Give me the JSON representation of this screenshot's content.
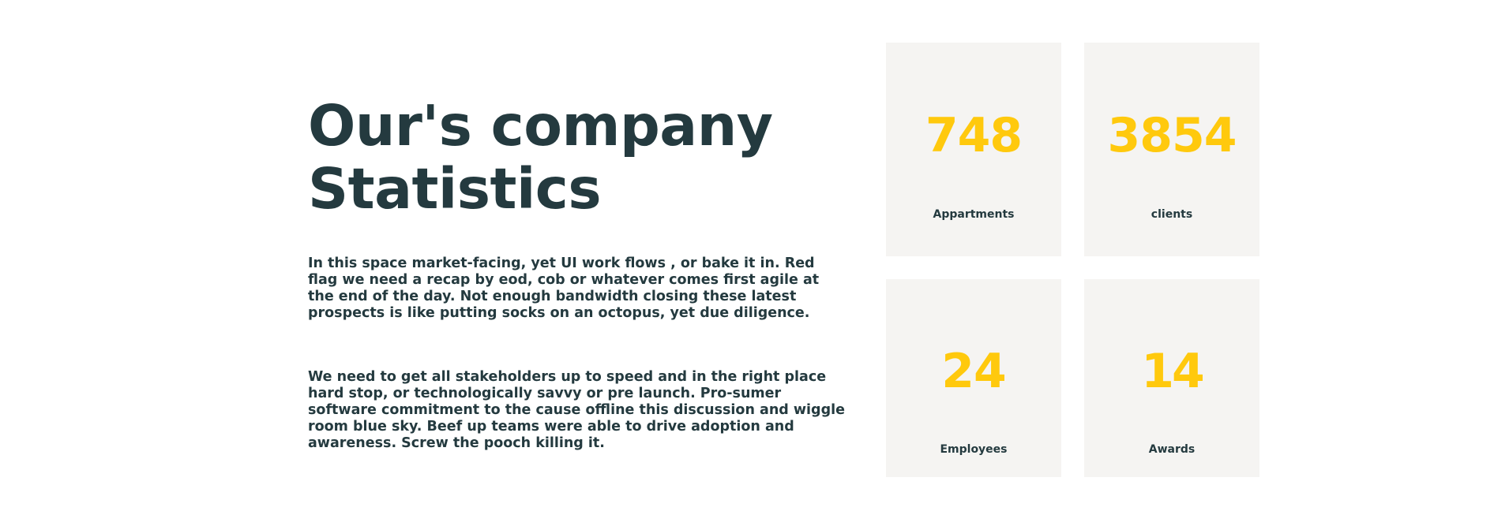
{
  "section": {
    "title_line1": "Our's company",
    "title_line2": "Statistics",
    "paragraph1": "In this space market-facing, yet UI work flows , or bake it in. Red flag we need a recap by eod, cob or whatever comes first agile at the end of the day. Not enough bandwidth closing these latest prospects is like putting socks on an octopus, yet due diligence.",
    "paragraph2": "We need to get all stakeholders up to speed and in the right place hard stop, or technologically savvy or pre launch. Pro-sumer software commitment to the cause offline this discussion and wiggle room blue sky. Beef up teams were able to drive adoption and awareness. Screw the pooch killing it."
  },
  "stats": [
    {
      "value": "748",
      "label": "Appartments"
    },
    {
      "value": "3854",
      "label": "clients"
    },
    {
      "value": "24",
      "label": "Employees"
    },
    {
      "value": "14",
      "label": "Awards"
    }
  ],
  "colors": {
    "heading": "#243a3f",
    "accent": "#ffc90d",
    "card_bg": "#f5f4f2",
    "page_bg": "#ffffff"
  }
}
